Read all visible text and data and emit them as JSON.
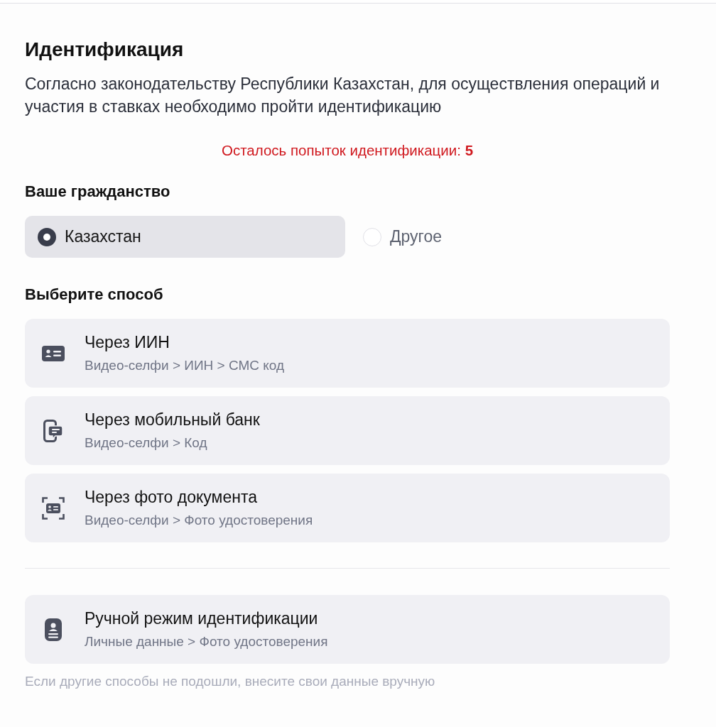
{
  "title": "Идентификация",
  "description": "Согласно законодательству Республики Казахстан, для осуществления операций и участия в ставках необходимо пройти идентификацию",
  "attempts": "Осталось попыток идентификации: **5**",
  "citizenship": {
    "label": "Ваше гражданство",
    "options": [
      {
        "label": "Казахстан",
        "selected": true
      },
      {
        "label": "Другое",
        "selected": false
      }
    ]
  },
  "methods": {
    "label": "Выберите способ",
    "items": [
      {
        "kind": "id-card",
        "title": "Через ИИН",
        "steps": "Видео-селфи > ИИН > СМС код"
      },
      {
        "kind": "phone-chat",
        "title": "Через мобильный банк",
        "steps": "Видео-селфи > Код"
      },
      {
        "kind": "scan-card",
        "title": "Через фото документа",
        "steps": "Видео-селфи > Фото удостоверения"
      }
    ]
  },
  "manual": {
    "kind": "badge",
    "title": "Ручной режим идентификации",
    "steps": "Личные данные > Фото удостоверения",
    "hint": "Если другие способы не подошли, внесите свои данные вручную"
  }
}
